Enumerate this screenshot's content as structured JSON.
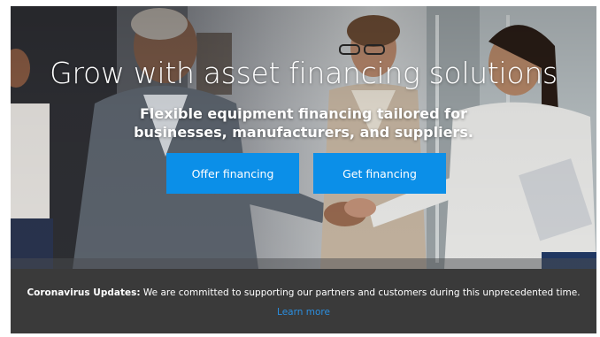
{
  "hero": {
    "title": "Grow with asset financing solutions",
    "subtitle_line1": "Flexible equipment financing tailored for",
    "subtitle_line2": "businesses, manufacturers, and suppliers.",
    "offer_button": "Offer financing",
    "get_button": "Get financing",
    "button_color": "#0b8fe8"
  },
  "notice": {
    "heading": "Coronavirus Updates:",
    "message": "We are committed to supporting our partners and customers during this unprecedented time.",
    "link_text": "Learn more",
    "link_color": "#2b8fe0",
    "background": "#3a3a3a"
  }
}
